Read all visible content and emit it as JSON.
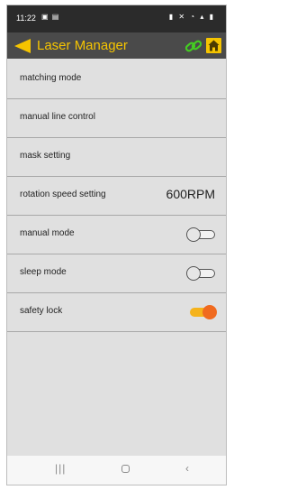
{
  "status_bar": {
    "time": "11:22",
    "left_icons": "▣ ▤",
    "right_icons": "▮ ✕ ◔ ▴ ▮"
  },
  "app_bar": {
    "title": "Laser Manager",
    "back_icon": "back-arrow-icon",
    "link_icon": "link-icon",
    "home_icon": "home-icon",
    "accent_color": "#f5c400"
  },
  "settings": [
    {
      "label": "matching mode"
    },
    {
      "label": "manual line control"
    },
    {
      "label": "mask setting"
    },
    {
      "label": "rotation speed setting",
      "value": "600RPM"
    },
    {
      "label": "manual mode",
      "toggle": false
    },
    {
      "label": "sleep mode",
      "toggle": false
    },
    {
      "label": "safety lock",
      "toggle": true
    }
  ],
  "colors": {
    "toggle_on_track": "#f5b31c",
    "toggle_on_thumb": "#f06a1f",
    "link_icon": "#44cc22"
  },
  "nav_bar": {
    "recents": "|||",
    "back": "‹"
  }
}
